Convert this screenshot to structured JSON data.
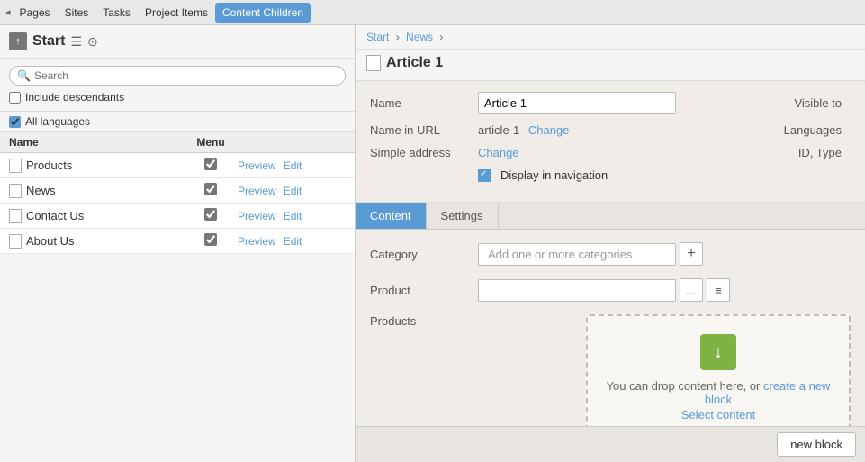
{
  "topNav": {
    "arrow": "◂",
    "items": [
      {
        "id": "pages",
        "label": "Pages",
        "active": false
      },
      {
        "id": "sites",
        "label": "Sites",
        "active": false
      },
      {
        "id": "tasks",
        "label": "Tasks",
        "active": false
      },
      {
        "id": "project-items",
        "label": "Project Items",
        "active": false
      },
      {
        "id": "content-children",
        "label": "Content Children",
        "active": true
      }
    ]
  },
  "sidebar": {
    "startTitle": "Start",
    "menuIcon": "☰",
    "settingsIcon": "⊙",
    "uploadIcon": "↑",
    "searchPlaceholder": "Search",
    "includeLabel": "Include descendants",
    "allLanguagesLabel": "All languages",
    "tableHeaders": {
      "name": "Name",
      "menu": "Menu"
    },
    "rows": [
      {
        "name": "Products",
        "menuChecked": true,
        "preview": "Preview",
        "edit": "Edit"
      },
      {
        "name": "News",
        "menuChecked": true,
        "preview": "Preview",
        "edit": "Edit"
      },
      {
        "name": "Contact Us",
        "menuChecked": true,
        "preview": "Preview",
        "edit": "Edit"
      },
      {
        "name": "About Us",
        "menuChecked": true,
        "preview": "Preview",
        "edit": "Edit"
      }
    ]
  },
  "breadcrumb": {
    "start": "Start",
    "news": "News",
    "sep": "›"
  },
  "article": {
    "title": "Article 1",
    "fields": {
      "nameLabel": "Name",
      "nameValue": "Article 1",
      "visibleToLabel": "Visible to",
      "nameInUrlLabel": "Name in URL",
      "nameInUrlValue": "article-1",
      "changeLabel": "Change",
      "languagesLabel": "Languages",
      "simpleAddressLabel": "Simple address",
      "simpleAddressChange": "Change",
      "idTypeLabel": "ID, Type",
      "displayNavLabel": "Display in navigation"
    }
  },
  "tabs": [
    {
      "id": "content",
      "label": "Content",
      "active": true
    },
    {
      "id": "settings",
      "label": "Settings",
      "active": false
    }
  ],
  "contentForm": {
    "categoryLabel": "Category",
    "categoryPlaceholder": "Add one or more categories",
    "plusIcon": "+",
    "productLabel": "Product",
    "productsLabel": "Products",
    "ellipsisIcon": "…",
    "listIcon": "≡",
    "dropText": "You can drop content here, or",
    "createNewBlockLink": "create a new block",
    "selectContentLink": "Select content"
  },
  "bottomBar": {
    "newBlockLabel": "new block"
  }
}
